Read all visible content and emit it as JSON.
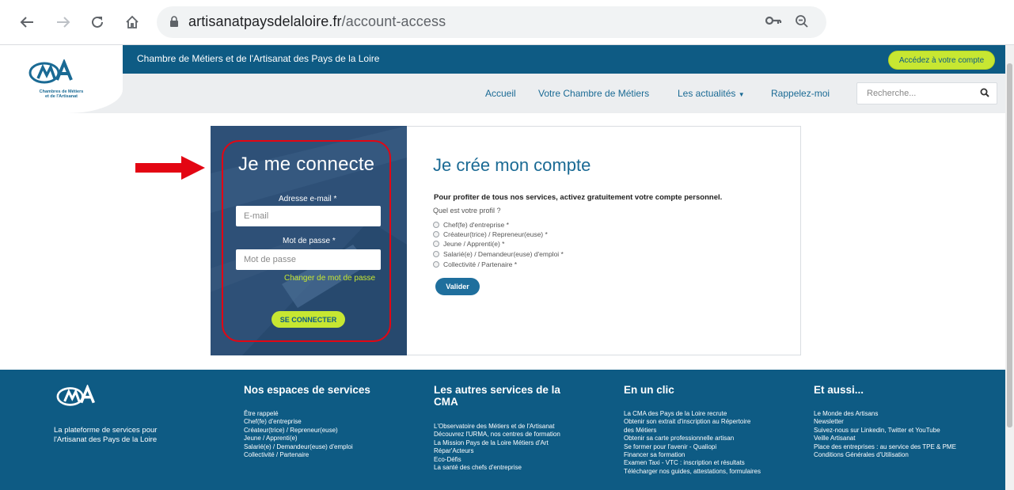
{
  "browser": {
    "url_domain": "artisanatpaysdelaloire.fr",
    "url_path": "/account-access",
    "icons": [
      "back-icon",
      "forward-icon",
      "reload-icon",
      "home-icon",
      "lock-icon",
      "key-icon",
      "zoom-icon"
    ]
  },
  "header": {
    "org_name": "Chambre de Métiers et de l'Artisanat des Pays de la Loire",
    "account_button": "Accédez à votre compte",
    "logo_caption_1": "Chambres de Métiers",
    "logo_caption_2": "et de l'Artisanat"
  },
  "nav": {
    "items": [
      "Accueil",
      "Votre Chambre de Métiers",
      "Les actualités",
      "Rappelez-moi"
    ],
    "search_placeholder": "Recherche..."
  },
  "login": {
    "title": "Je me connecte",
    "email_label": "Adresse e-mail *",
    "email_placeholder": "E-mail",
    "password_label": "Mot de passe *",
    "password_placeholder": "Mot de passe",
    "change_password": "Changer de mot de passe",
    "submit": "SE CONNECTER"
  },
  "signup": {
    "title": "Je crée mon compte",
    "intro": "Pour profiter de tous nos services, activez gratuitement votre compte personnel.",
    "question": "Quel est votre profil ?",
    "profiles": [
      "Chef(fe) d'entreprise *",
      "Créateur(trice) / Repreneur(euse) *",
      "Jeune / Apprenti(e) *",
      "Salarié(e) / Demandeur(euse) d'emploi *",
      "Collectivité / Partenaire *"
    ],
    "submit": "Valider"
  },
  "footer": {
    "tagline": "La plateforme de services pour l'Artisanat des Pays de la Loire",
    "col1": {
      "title": "Nos espaces de services",
      "links": [
        "Être rappelé",
        "Chef(fe) d'entreprise",
        "Créateur(trice) / Repreneur(euse)",
        "Jeune / Apprenti(e)",
        "Salarié(e) / Demandeur(euse) d'emploi",
        "Collectivité / Partenaire"
      ]
    },
    "col2": {
      "title": "Les autres services de la CMA",
      "links": [
        "L'Observatoire des Métiers et de l'Artisanat",
        "Découvrez l'URMA, nos centres de formation",
        "La Mission Pays de la Loire Métiers d'Art",
        "Répar'Acteurs",
        "Eco-Défis",
        "La santé des chefs d'entreprise"
      ]
    },
    "col3": {
      "title": "En un clic",
      "links": [
        "La CMA des Pays de la Loire recrute",
        "Obtenir son extrait d'inscription au Répertoire des Métiers",
        "Obtenir sa carte professionnelle artisan",
        "Se former pour l'avenir - Qualiopi",
        "Financer sa formation",
        "Examen Taxi - VTC : inscription et résultats",
        "Télécharger nos guides, attestations, formulaires"
      ]
    },
    "col4": {
      "title": "Et aussi...",
      "links": [
        "Le Monde des Artisans",
        "Newsletter",
        "Suivez-nous sur Linkedin, Twitter et YouTube",
        "Veille Artisanat",
        "Place des entreprises : au service des TPE & PME",
        "Conditions Générales d'Utilisation"
      ]
    }
  }
}
